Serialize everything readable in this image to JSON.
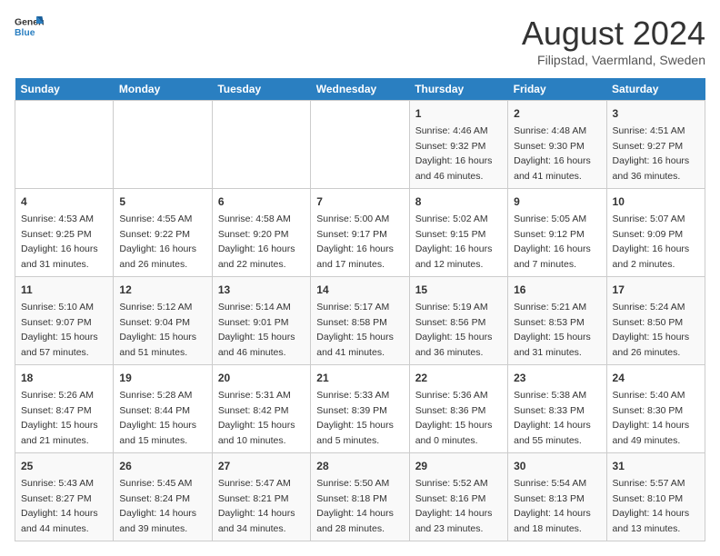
{
  "header": {
    "logo_line1": "General",
    "logo_line2": "Blue",
    "title": "August 2024",
    "subtitle": "Filipstad, Vaermland, Sweden"
  },
  "calendar": {
    "days_of_week": [
      "Sunday",
      "Monday",
      "Tuesday",
      "Wednesday",
      "Thursday",
      "Friday",
      "Saturday"
    ],
    "weeks": [
      [
        {
          "day": "",
          "info": ""
        },
        {
          "day": "",
          "info": ""
        },
        {
          "day": "",
          "info": ""
        },
        {
          "day": "",
          "info": ""
        },
        {
          "day": "1",
          "info": "Sunrise: 4:46 AM\nSunset: 9:32 PM\nDaylight: 16 hours\nand 46 minutes."
        },
        {
          "day": "2",
          "info": "Sunrise: 4:48 AM\nSunset: 9:30 PM\nDaylight: 16 hours\nand 41 minutes."
        },
        {
          "day": "3",
          "info": "Sunrise: 4:51 AM\nSunset: 9:27 PM\nDaylight: 16 hours\nand 36 minutes."
        }
      ],
      [
        {
          "day": "4",
          "info": "Sunrise: 4:53 AM\nSunset: 9:25 PM\nDaylight: 16 hours\nand 31 minutes."
        },
        {
          "day": "5",
          "info": "Sunrise: 4:55 AM\nSunset: 9:22 PM\nDaylight: 16 hours\nand 26 minutes."
        },
        {
          "day": "6",
          "info": "Sunrise: 4:58 AM\nSunset: 9:20 PM\nDaylight: 16 hours\nand 22 minutes."
        },
        {
          "day": "7",
          "info": "Sunrise: 5:00 AM\nSunset: 9:17 PM\nDaylight: 16 hours\nand 17 minutes."
        },
        {
          "day": "8",
          "info": "Sunrise: 5:02 AM\nSunset: 9:15 PM\nDaylight: 16 hours\nand 12 minutes."
        },
        {
          "day": "9",
          "info": "Sunrise: 5:05 AM\nSunset: 9:12 PM\nDaylight: 16 hours\nand 7 minutes."
        },
        {
          "day": "10",
          "info": "Sunrise: 5:07 AM\nSunset: 9:09 PM\nDaylight: 16 hours\nand 2 minutes."
        }
      ],
      [
        {
          "day": "11",
          "info": "Sunrise: 5:10 AM\nSunset: 9:07 PM\nDaylight: 15 hours\nand 57 minutes."
        },
        {
          "day": "12",
          "info": "Sunrise: 5:12 AM\nSunset: 9:04 PM\nDaylight: 15 hours\nand 51 minutes."
        },
        {
          "day": "13",
          "info": "Sunrise: 5:14 AM\nSunset: 9:01 PM\nDaylight: 15 hours\nand 46 minutes."
        },
        {
          "day": "14",
          "info": "Sunrise: 5:17 AM\nSunset: 8:58 PM\nDaylight: 15 hours\nand 41 minutes."
        },
        {
          "day": "15",
          "info": "Sunrise: 5:19 AM\nSunset: 8:56 PM\nDaylight: 15 hours\nand 36 minutes."
        },
        {
          "day": "16",
          "info": "Sunrise: 5:21 AM\nSunset: 8:53 PM\nDaylight: 15 hours\nand 31 minutes."
        },
        {
          "day": "17",
          "info": "Sunrise: 5:24 AM\nSunset: 8:50 PM\nDaylight: 15 hours\nand 26 minutes."
        }
      ],
      [
        {
          "day": "18",
          "info": "Sunrise: 5:26 AM\nSunset: 8:47 PM\nDaylight: 15 hours\nand 21 minutes."
        },
        {
          "day": "19",
          "info": "Sunrise: 5:28 AM\nSunset: 8:44 PM\nDaylight: 15 hours\nand 15 minutes."
        },
        {
          "day": "20",
          "info": "Sunrise: 5:31 AM\nSunset: 8:42 PM\nDaylight: 15 hours\nand 10 minutes."
        },
        {
          "day": "21",
          "info": "Sunrise: 5:33 AM\nSunset: 8:39 PM\nDaylight: 15 hours\nand 5 minutes."
        },
        {
          "day": "22",
          "info": "Sunrise: 5:36 AM\nSunset: 8:36 PM\nDaylight: 15 hours\nand 0 minutes."
        },
        {
          "day": "23",
          "info": "Sunrise: 5:38 AM\nSunset: 8:33 PM\nDaylight: 14 hours\nand 55 minutes."
        },
        {
          "day": "24",
          "info": "Sunrise: 5:40 AM\nSunset: 8:30 PM\nDaylight: 14 hours\nand 49 minutes."
        }
      ],
      [
        {
          "day": "25",
          "info": "Sunrise: 5:43 AM\nSunset: 8:27 PM\nDaylight: 14 hours\nand 44 minutes."
        },
        {
          "day": "26",
          "info": "Sunrise: 5:45 AM\nSunset: 8:24 PM\nDaylight: 14 hours\nand 39 minutes."
        },
        {
          "day": "27",
          "info": "Sunrise: 5:47 AM\nSunset: 8:21 PM\nDaylight: 14 hours\nand 34 minutes."
        },
        {
          "day": "28",
          "info": "Sunrise: 5:50 AM\nSunset: 8:18 PM\nDaylight: 14 hours\nand 28 minutes."
        },
        {
          "day": "29",
          "info": "Sunrise: 5:52 AM\nSunset: 8:16 PM\nDaylight: 14 hours\nand 23 minutes."
        },
        {
          "day": "30",
          "info": "Sunrise: 5:54 AM\nSunset: 8:13 PM\nDaylight: 14 hours\nand 18 minutes."
        },
        {
          "day": "31",
          "info": "Sunrise: 5:57 AM\nSunset: 8:10 PM\nDaylight: 14 hours\nand 13 minutes."
        }
      ]
    ]
  }
}
